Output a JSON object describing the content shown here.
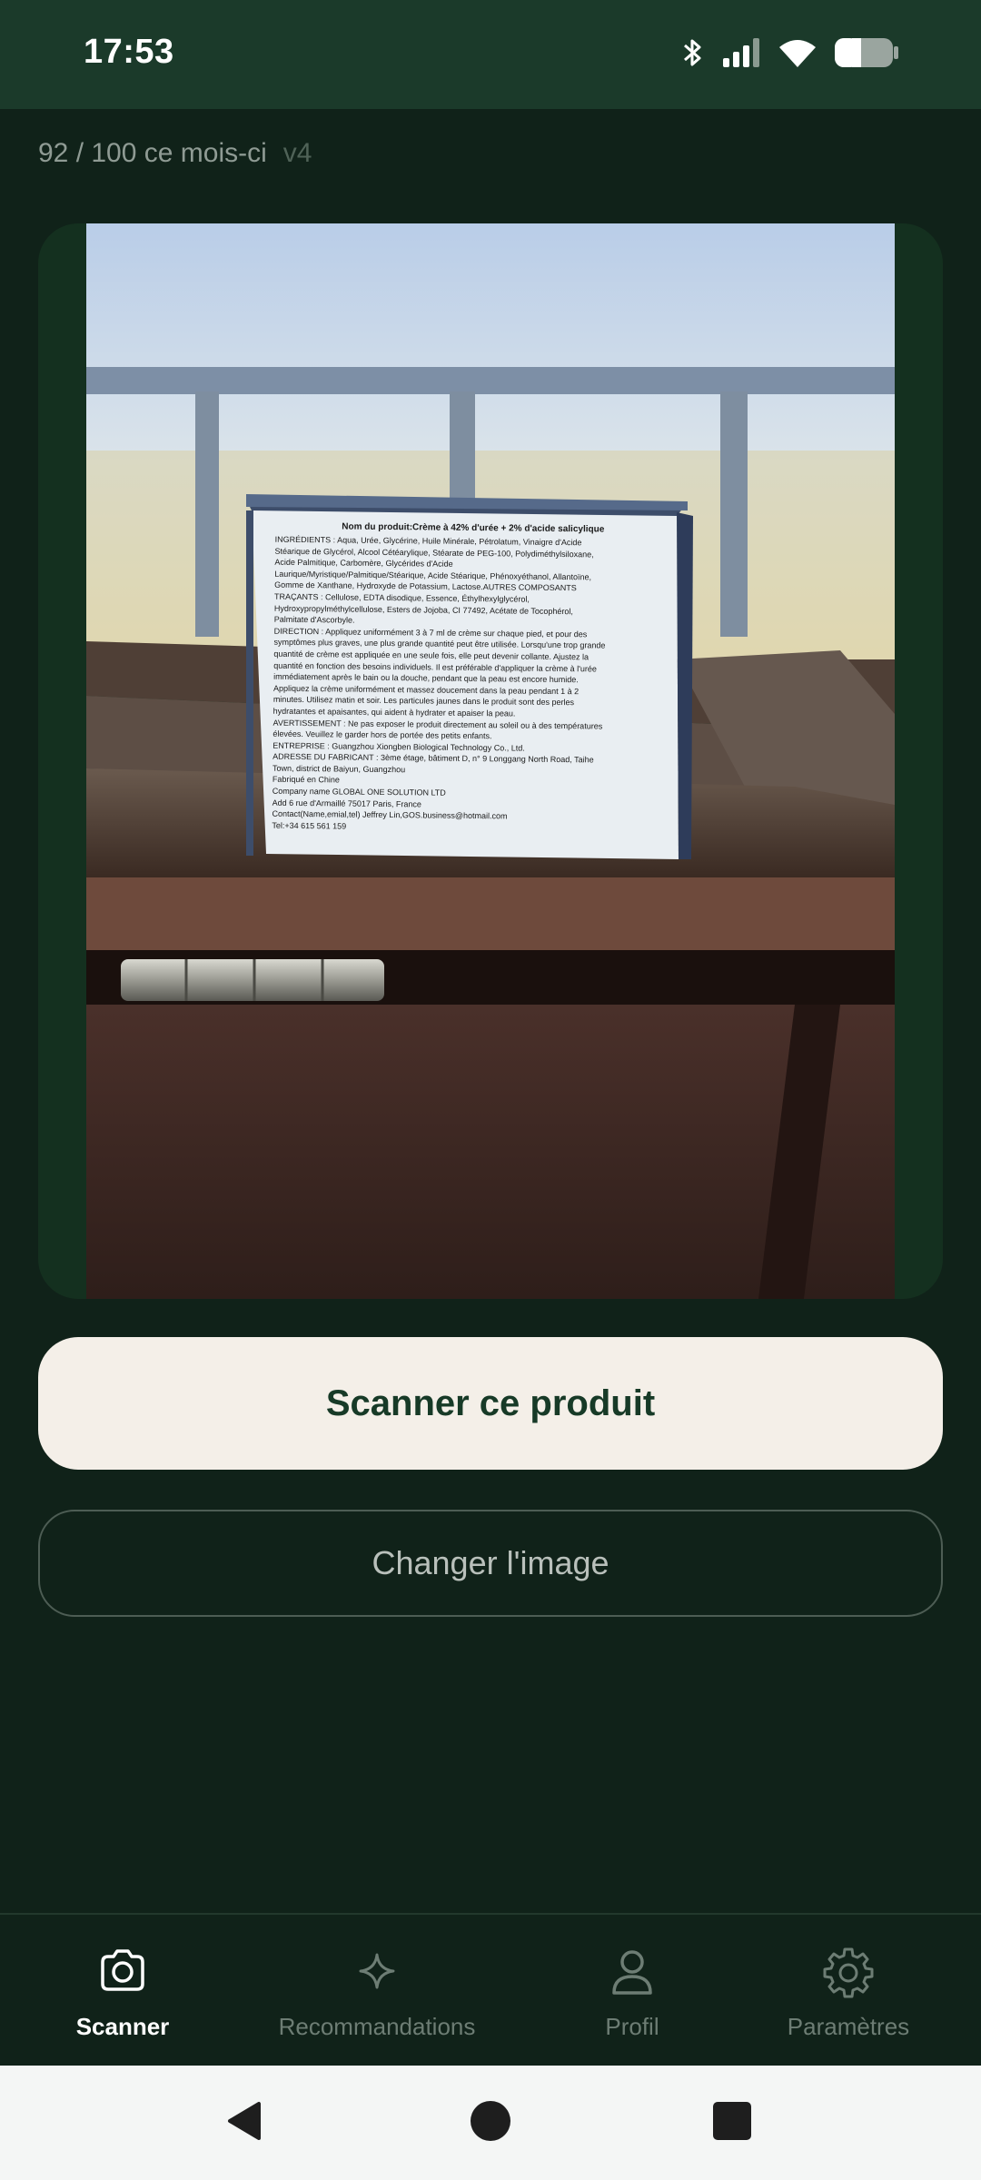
{
  "status_bar": {
    "time": "17:53",
    "icons": [
      "bluetooth-icon",
      "signal-icon",
      "wifi-icon",
      "battery-icon"
    ]
  },
  "usage": {
    "count_text": "92 / 100 ce mois-ci",
    "version": "v4"
  },
  "image": {
    "box_title": "Nom du produit:Crème à 42% d'urée + 2% d'acide salicylique",
    "box_lines": [
      "INGRÉDIENTS : Aqua, Urée, Glycérine, Huile Minérale, Pétrolatum, Vinaigre d'Acide",
      "Stéarique de Glycérol, Alcool Cétéarylique, Stéarate de PEG-100, Polydiméthylsiloxane,",
      "Acide Palmitique, Carbomère, Glycérides d'Acide",
      "Laurique/Myristique/Palmitique/Stéarique, Acide Stéarique, Phénoxyéthanol, Allantoïne,",
      "Gomme de Xanthane, Hydroxyde de Potassium, Lactose.AUTRES COMPOSANTS",
      "TRAÇANTS : Cellulose, EDTA disodique, Essence, Éthylhexylglycérol,",
      "Hydroxypropylméthylcellulose, Esters de Jojoba, CI 77492, Acétate de Tocophérol,",
      "Palmitate d'Ascorbyle.",
      "DIRECTION : Appliquez uniformément 3 à 7 ml de crème sur chaque pied, et pour des",
      "symptômes plus graves, une plus grande quantité peut être utilisée. Lorsqu'une trop grande",
      "quantité de crème est appliquée en une seule fois, elle peut devenir collante. Ajustez la",
      "quantité en fonction des besoins individuels. Il est préférable d'appliquer la crème à l'urée",
      "immédiatement après le bain ou la douche, pendant que la peau est encore humide.",
      "Appliquez la crème uniformément et massez doucement dans la peau pendant 1 à 2",
      "minutes. Utilisez matin et soir. Les particules jaunes dans le produit sont des perles",
      "hydratantes et apaisantes, qui aident à hydrater et apaiser la peau.",
      "AVERTISSEMENT : Ne pas exposer le produit directement au soleil ou à des températures",
      "élevées. Veuillez le garder hors de portée des petits enfants.",
      "ENTREPRISE : Guangzhou Xiongben Biological Technology Co., Ltd.",
      "ADRESSE DU FABRICANT : 3ème étage, bâtiment D, n° 9 Longgang North Road, Taihe",
      "Town, district de Baiyun, Guangzhou",
      "Fabriqué en Chine",
      "Company name GLOBAL ONE SOLUTION LTD",
      "Add 6 rue d'Armaillé 75017 Paris, France",
      "Contact(Name,emial,tel) Jeffrey Lin,GOS.business@hotmail.com",
      "Tel:+34 615 561 159"
    ]
  },
  "actions": {
    "scan_label": "Scanner ce produit",
    "change_label": "Changer l'image"
  },
  "nav": {
    "items": [
      {
        "label": "Scanner",
        "icon": "camera-icon",
        "active": true
      },
      {
        "label": "Recommandations",
        "icon": "sparkle-icon",
        "active": false
      },
      {
        "label": "Profil",
        "icon": "person-icon",
        "active": false
      },
      {
        "label": "Paramètres",
        "icon": "gear-icon",
        "active": false
      }
    ]
  },
  "colors": {
    "background": "#102219",
    "status_bar": "#1b3a2a",
    "primary_button": "#f4efe8",
    "primary_button_text": "#173a27"
  }
}
